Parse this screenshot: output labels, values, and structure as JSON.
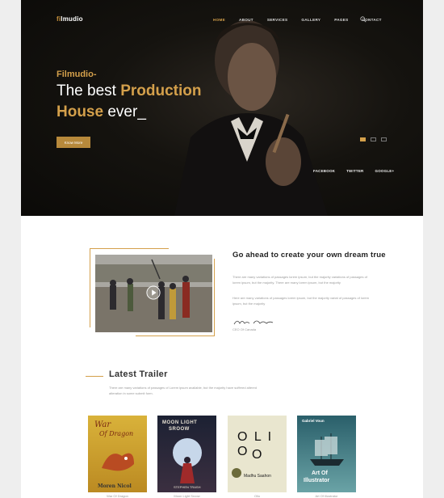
{
  "brand": {
    "logo_prefix": "fi",
    "logo_rest": "lmudio"
  },
  "nav": {
    "links": [
      "HOME",
      "ABOUT",
      "SERVICES",
      "GALLERY",
      "PAGES",
      "CONTACT"
    ]
  },
  "hero": {
    "kicker": "Filmudio-",
    "title_line1_a": "The best ",
    "title_line1_b": "Production",
    "title_line2_a": "House",
    "title_line2_b": " ever_",
    "button_label": "Know More",
    "socials": [
      "FACEBOOK",
      "TWITTER",
      "GOOGLE+"
    ]
  },
  "about": {
    "title": "Go ahead to create your own dream true",
    "para1": "There are many variations of passages lorem ipsum, but the majority variations of passages of lorem ipsum, but the majority. There are many lorem ipsum, but the majority",
    "para2": "Here are many variations of passages lorem ipsum, but the majority variat of passages of lorem ipsum, but the majority",
    "signature_caption": "CEO Of Canada"
  },
  "trailer": {
    "title": "Latest Trailer",
    "description": "There are many variations of passages of Lorem ipsum available, but the majority have suffered altered alteration in some submit form."
  },
  "posters": [
    {
      "line1": "War",
      "line2": "Of Dragon",
      "author": "Moren Nicol",
      "caption": "War Of Dragon"
    },
    {
      "line1": "MOON LIGHT",
      "line2": "SROOW",
      "author": "STEPHEN TRASH",
      "caption": "Moon Light Sroow"
    },
    {
      "line1": "O L I O",
      "line2": "O",
      "author": "Madhu Saahon",
      "caption": "Olio"
    },
    {
      "line1": "Art Of",
      "line2": "Illustrator",
      "author": "Gabriel Voun",
      "caption": "Art Of Illustrator"
    }
  ],
  "colors": {
    "accent": "#d4a04b",
    "hero_bg": "#0b0a08",
    "button": "#b7893b"
  }
}
